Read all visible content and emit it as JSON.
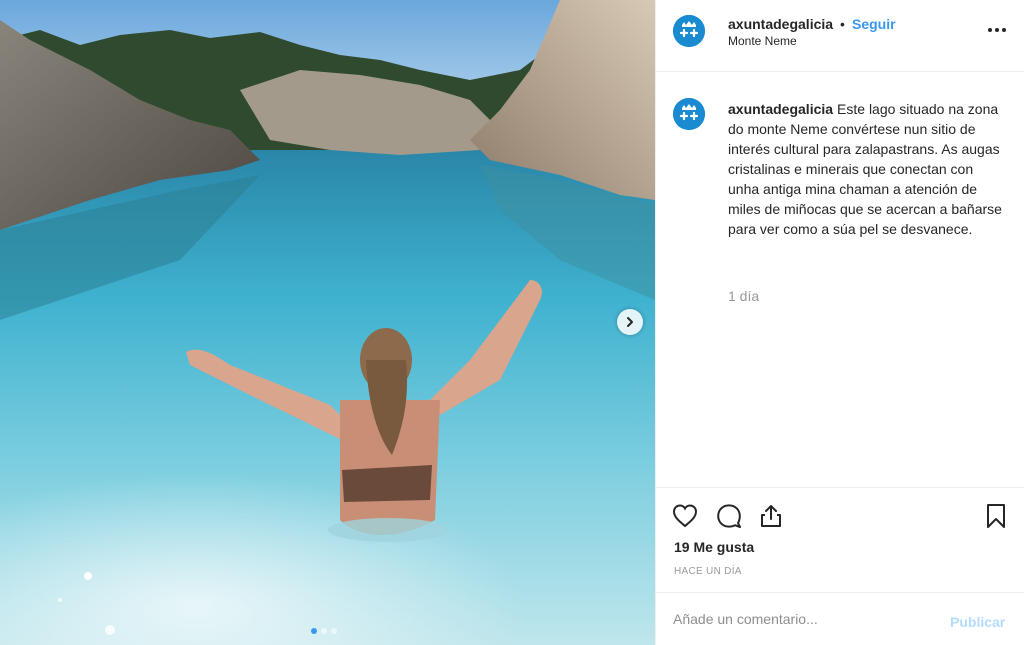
{
  "post": {
    "author": {
      "username": "axuntadegalicia",
      "location": "Monte Neme"
    },
    "header": {
      "separator": "•",
      "follow_label": "Seguir"
    },
    "caption": {
      "username": "axuntadegalicia",
      "text": "Este lago situado na zona do monte Neme convértese nun sitio de interés cultural para zalapastrans. As augas cristalinas e minerais que conectan con unha antiga mina chaman a atención de miles de miñocas que se acercan a bañarse para ver como a súa pel se desvanece.",
      "age": "1 día"
    },
    "stats": {
      "likes_text": "19 Me gusta",
      "timestamp": "HACE UN DÍA"
    },
    "composer": {
      "placeholder": "Añade un comentario...",
      "publish_label": "Publicar"
    },
    "carousel": {
      "total": 3,
      "active": 1
    },
    "icons": {
      "more": "more-options-icon",
      "like": "heart-icon",
      "comment": "comment-bubble-icon",
      "share": "share-icon",
      "save": "bookmark-icon",
      "next": "chevron-right-icon"
    },
    "colors": {
      "link_blue": "#3897f0",
      "publish_disabled": "#b3dbff",
      "muted_text": "#999999",
      "avatar_blue": "#1a8ad1"
    }
  }
}
